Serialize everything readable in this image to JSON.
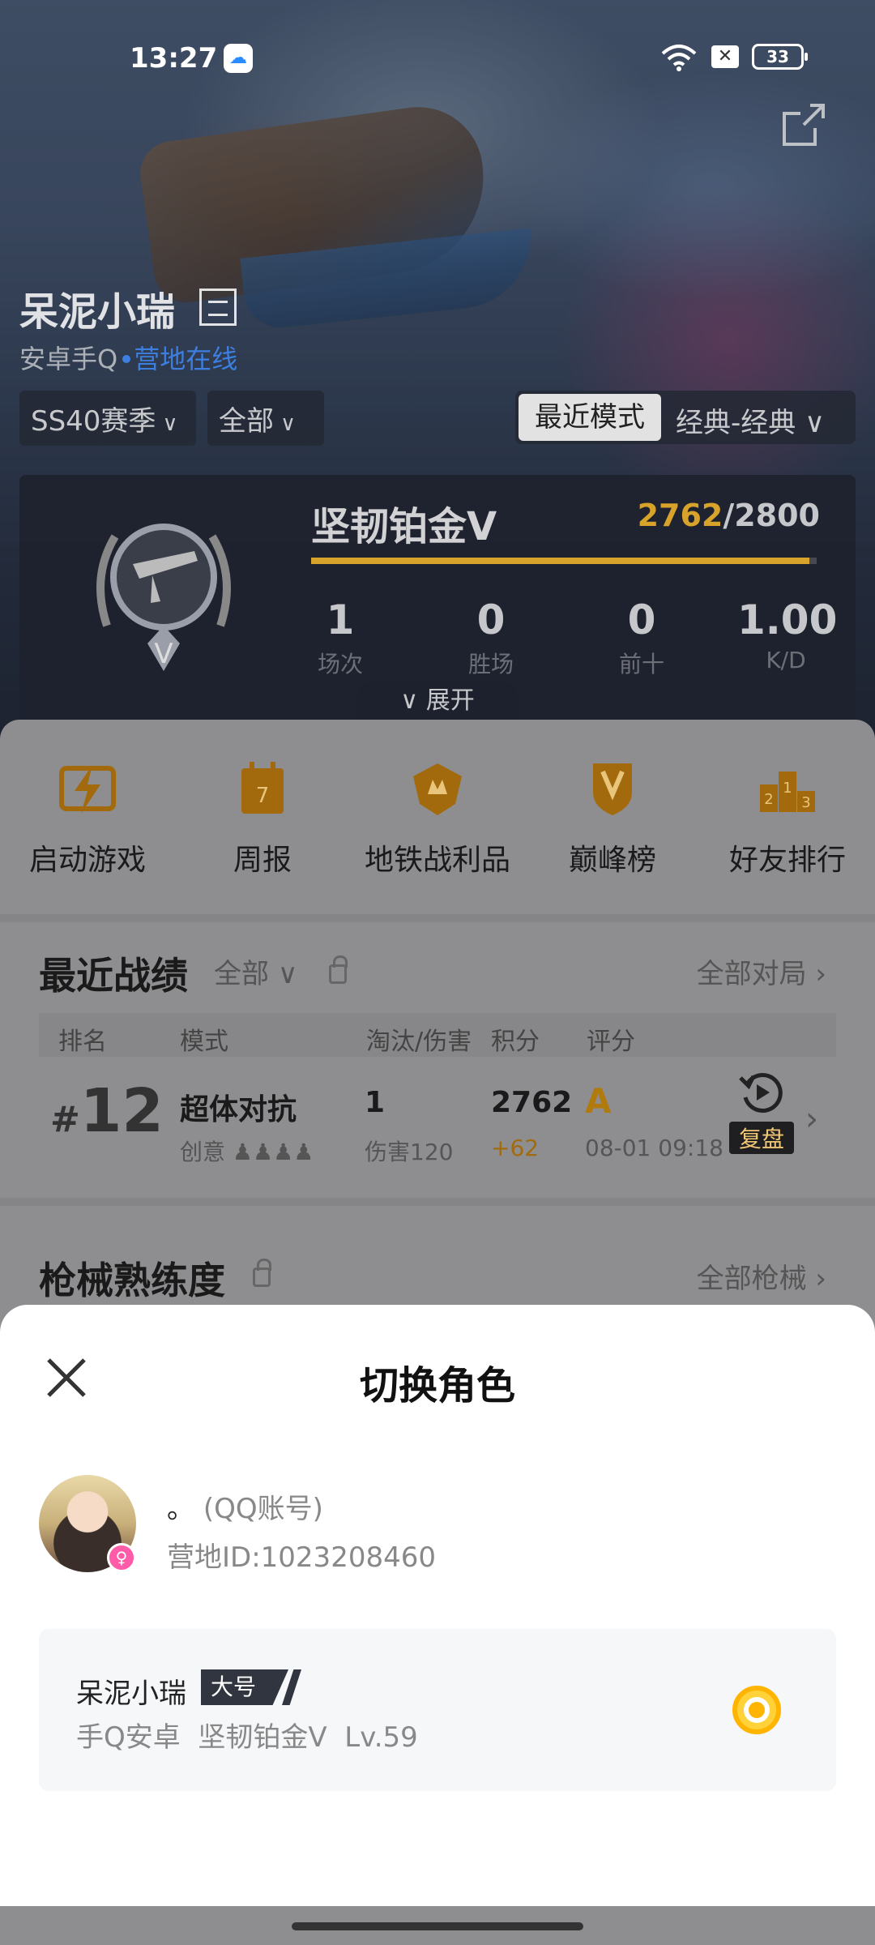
{
  "status_bar": {
    "time": "13:27",
    "battery": "33"
  },
  "profile": {
    "name": "呆泥小瑞",
    "platform": "安卓手Q",
    "camp_status": "营地在线"
  },
  "filters": {
    "season": "SS40赛季",
    "scope": "全部",
    "mode_active": "最近模式",
    "mode_other": "经典-经典"
  },
  "rank": {
    "title": "坚韧铂金V",
    "current_points": "2762",
    "max_points": "/2800",
    "progress": 0.986,
    "stats": [
      {
        "value": "1",
        "label": "场次"
      },
      {
        "value": "0",
        "label": "胜场"
      },
      {
        "value": "0",
        "label": "前十"
      },
      {
        "value": "1.00",
        "label": "K/D"
      }
    ],
    "expand_label": "展开"
  },
  "quick_actions": [
    {
      "label": "启动游戏",
      "icon": "lightning-icon"
    },
    {
      "label": "周报",
      "icon": "calendar-icon"
    },
    {
      "label": "地铁战利品",
      "icon": "crest-icon"
    },
    {
      "label": "巅峰榜",
      "icon": "trophy-shield-icon"
    },
    {
      "label": "好友排行",
      "icon": "podium-icon"
    }
  ],
  "recent_matches": {
    "title": "最近战绩",
    "filter": "全部",
    "link": "全部对局",
    "columns": [
      "排名",
      "模式",
      "淘汰/伤害",
      "积分",
      "评分"
    ],
    "rows": [
      {
        "rank_prefix": "#",
        "rank": "12",
        "mode": "超体对抗",
        "mode_sub": "创意",
        "kills": "1",
        "damage": "伤害120",
        "points": "2762",
        "delta": "+62",
        "grade": "A",
        "time": "08-01 09:18",
        "replay": "复盘"
      }
    ]
  },
  "weapons": {
    "title": "枪械熟练度",
    "link": "全部枪械"
  },
  "sheet": {
    "title": "切换角色",
    "account_name": "。",
    "account_type": "(QQ账号)",
    "camp_id": "营地ID:1023208460",
    "role": {
      "name": "呆泥小瑞",
      "tag": "大号",
      "platform": "手Q安卓",
      "rank": "坚韧铂金V",
      "level": "Lv.59",
      "selected": true
    }
  },
  "colors": {
    "accent": "#d8a32a",
    "camp_blue": "#3d7fe0",
    "radio": "#ffb400"
  }
}
